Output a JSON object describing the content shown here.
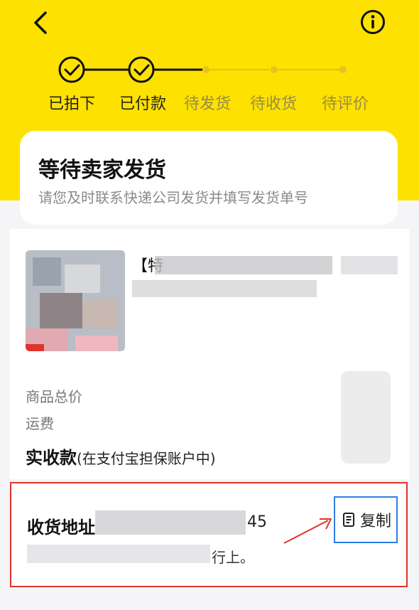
{
  "header": {
    "bg_color": "#fde100"
  },
  "nav": {
    "back_icon": "chevron-left-icon",
    "info_icon": "info-icon"
  },
  "progress": {
    "steps": [
      {
        "label": "已拍下",
        "done": true
      },
      {
        "label": "已付款",
        "done": true
      },
      {
        "label": "待发货",
        "done": false
      },
      {
        "label": "待收货",
        "done": false
      },
      {
        "label": "待评价",
        "done": false
      }
    ]
  },
  "status_card": {
    "title": "等待卖家发货",
    "subtitle": "请您及时联系快递公司发货并填写发货单号"
  },
  "product": {
    "title_prefix": "【特"
  },
  "price_rows": {
    "total_label": "商品总价",
    "shipping_label": "运费"
  },
  "actual": {
    "label": "实收款",
    "note": "(在支付宝担保账户中)"
  },
  "address": {
    "label": "收货地址",
    "visible_tail": "45",
    "visible_end": "行上。",
    "copy_label": "复制",
    "highlight_color": "#e0342b",
    "copy_border_color": "#2f7ee0"
  }
}
